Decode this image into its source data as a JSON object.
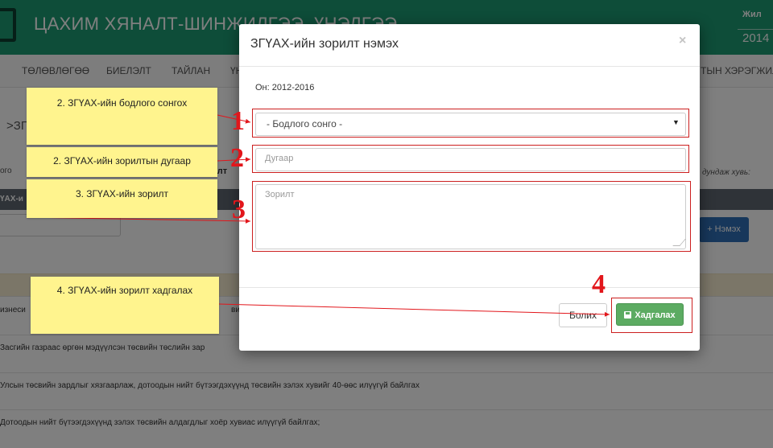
{
  "app": {
    "title": "ЦАХИМ ХЯНАЛТ-ШИНЖИЛГЭЭ, ҮНЭЛГЭЭ",
    "year_label": "Жил",
    "year_value": "2014"
  },
  "nav": {
    "items": [
      "ТӨЛӨВЛӨГӨӨ",
      "БИЕЛЭЛТ",
      "ТАЙЛАН",
      "ҮН"
    ],
    "right_item": "ТЫН ХЭРЭГЖИЛ"
  },
  "background": {
    "page_sub": ">ЗГ",
    "label_gro": "ого",
    "label_bold": "элт",
    "label_avg": "дундаж хувь:",
    "tab_label": "ҮАХ-и",
    "add_button": "+ Нэмэх",
    "rows": [
      "изнеси",
      "Засгийн газраас өргөн мэдүүлсэн төсвийн төслийн зар",
      "Улсын төсвийн зардлыг хязгаарлаж, дотоодын нийт бүтээгдэхүүнд төсвийн зэлэх хувийг 40-өөс илүүгүй байлгах",
      "Дотоодын нийт бүтээгдэхүүнд зэлэх төсвийн алдагдлыг хоёр хувиас илүүгүй байлгах;"
    ],
    "row_fragment": "винэ"
  },
  "modal": {
    "title": "ЗГҮАХ-ийн зорилт нэмэх",
    "close": "×",
    "year_range": "Он: 2012-2016",
    "select_value": "- Бодлого сонго -",
    "select_arrow": "▼",
    "number_placeholder": "Дугаар",
    "goal_placeholder": "Зорилт",
    "cancel_label": "Болих",
    "save_label": "Хадгалах"
  },
  "annotations": {
    "numbers": [
      "1",
      "2",
      "3",
      "4"
    ],
    "notes": [
      "2. ЗГҮАХ-ийн бодлого сонгох",
      "2. ЗГҮАХ-ийн зорилтын дугаар",
      "3. ЗГҮАХ-ийн зорилт",
      "4. ЗГҮАХ-ийн зорилт хадгалах"
    ],
    "color_red": "#e2161b",
    "color_note": "#fff48e"
  },
  "colors": {
    "header": "#1d9a72",
    "save_button": "#5cab62",
    "add_button": "#2f6fb6"
  }
}
